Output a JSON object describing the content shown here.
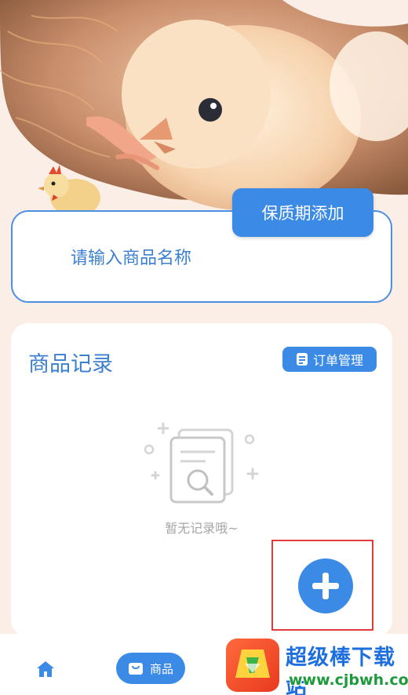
{
  "search": {
    "placeholder": "请输入商品名称",
    "add_button_label": "保质期添加"
  },
  "records": {
    "title": "商品记录",
    "orders_button_label": "订单管理",
    "empty_text": "暂无记录哦~"
  },
  "tabbar": {
    "goods_label": "商品"
  },
  "watermark": {
    "site_name": "超级棒下载站",
    "url": "www.cjbwh.com"
  },
  "colors": {
    "accent": "#3b8ae6",
    "title_blue": "#3b7fd1",
    "background": "#fbeee6",
    "highlight": "#e23b3b"
  },
  "icons": {
    "home": "home-icon",
    "goods": "bag-icon",
    "orders": "document-icon",
    "add": "plus-icon",
    "empty": "document-search-icon"
  }
}
